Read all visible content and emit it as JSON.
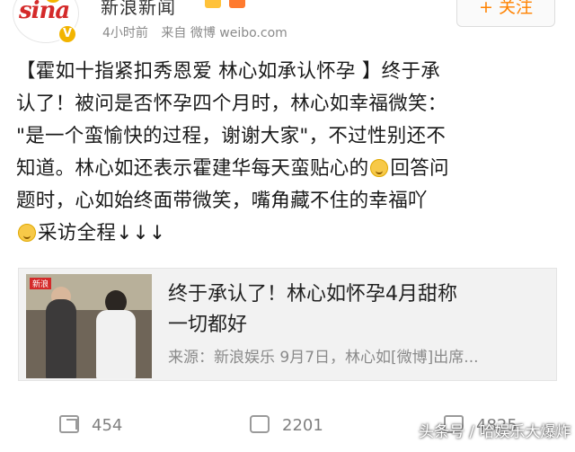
{
  "header": {
    "logo_text": "sina",
    "account_name": "新浪新闻",
    "verified_mark": "V",
    "time_ago": "4小时前",
    "source": "来自 微博 weibo.com",
    "follow_label": "+ 关注"
  },
  "post": {
    "lines": [
      "【霍如十指紧扣秀恩爱 林心如承认怀孕 】终于承",
      "认了！被问是否怀孕四个月时，林心如幸福微笑：",
      "\"是一个蛮愉快的过程，谢谢大家\"，不过性别还不",
      "知道。林心如还表示霍建华每天蛮贴心的",
      "回答问",
      "题时，心如始终面带微笑，嘴角藏不住的幸福吖",
      "采访全程↓↓↓"
    ]
  },
  "card": {
    "thumb_tag": "新浪",
    "title_line1": "终于承认了！林心如怀孕4月甜称",
    "title_line2": "一切都好",
    "source": "来源：新浪娱乐 9月7日，林心如[微博]出席..."
  },
  "actions": {
    "share_count": "454",
    "comment_count": "2201",
    "like_count": "4825"
  },
  "watermark": "头条号 / 哈娱乐大爆炸",
  "colors": {
    "accent": "#ff8200",
    "brand_red": "#d42a2a",
    "muted": "#8a8a8a",
    "card_bg": "#f2f2f2"
  }
}
